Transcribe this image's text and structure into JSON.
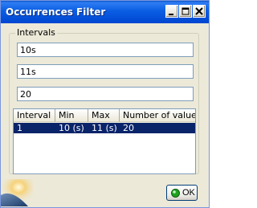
{
  "window": {
    "title": "Occurrences Filter",
    "controls": {
      "minimize": "minimize-icon",
      "maximize": "maximize-icon",
      "close": "close-icon"
    }
  },
  "intervals": {
    "label": "Intervals",
    "fields": [
      {
        "value": "10s"
      },
      {
        "value": "11s"
      },
      {
        "value": "20"
      }
    ],
    "table": {
      "columns": [
        "Interval",
        "Min",
        "Max",
        "Number of values"
      ],
      "rows": [
        {
          "interval": "1",
          "min": "10 (s)",
          "max": "11 (s)",
          "count": "20",
          "selected": true
        }
      ]
    }
  },
  "buttons": {
    "ok": "OK"
  },
  "colors": {
    "titlebar": "#0a55e3",
    "selection": "#0a246a",
    "dialog": "#ece9d8",
    "ok_led": "#1fa21f"
  }
}
